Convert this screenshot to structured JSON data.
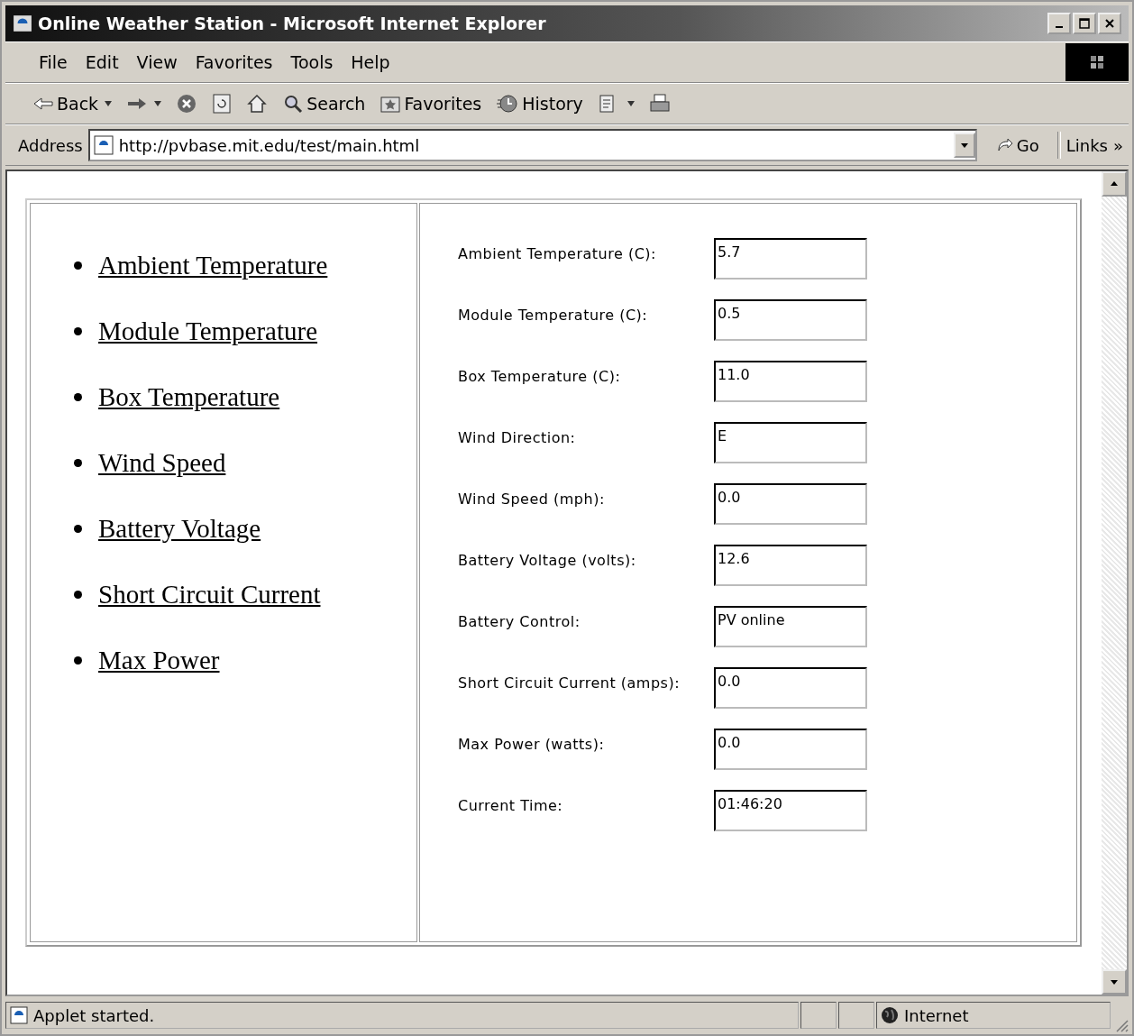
{
  "window": {
    "title": "Online Weather Station - Microsoft Internet Explorer"
  },
  "menu": [
    "File",
    "Edit",
    "View",
    "Favorites",
    "Tools",
    "Help"
  ],
  "toolbar": [
    {
      "kind": "back",
      "label": "Back"
    },
    {
      "kind": "forward"
    },
    {
      "kind": "stop"
    },
    {
      "kind": "refresh"
    },
    {
      "kind": "home"
    },
    {
      "kind": "search",
      "label": "Search"
    },
    {
      "kind": "favorites",
      "label": "Favorites"
    },
    {
      "kind": "history",
      "label": "History"
    },
    {
      "kind": "edit"
    },
    {
      "kind": "print"
    }
  ],
  "address": {
    "label": "Address",
    "value": "http://pvbase.mit.edu/test/main.html",
    "go": "Go",
    "links": "Links",
    "chevron": "»"
  },
  "nav_links": [
    "Ambient Temperature",
    "Module Temperature",
    "Box Temperature",
    "Wind Speed",
    "Battery Voltage",
    "Short Circuit Current",
    "Max Power"
  ],
  "readings": [
    {
      "label": "Ambient Temperature (C):",
      "value": "5.7"
    },
    {
      "label": "Module Temperature (C):",
      "value": "0.5"
    },
    {
      "label": "Box Temperature (C):",
      "value": "11.0"
    },
    {
      "label": "Wind Direction:",
      "value": "E"
    },
    {
      "label": "Wind Speed (mph):",
      "value": "0.0"
    },
    {
      "label": "Battery Voltage (volts):",
      "value": "12.6"
    },
    {
      "label": "Battery Control:",
      "value": "PV online"
    },
    {
      "label": "Short Circuit Current (amps):",
      "value": "0.0"
    },
    {
      "label": "Max Power (watts):",
      "value": "0.0"
    },
    {
      "label": "Current Time:",
      "value": "01:46:20"
    }
  ],
  "status": {
    "text": "Applet started.",
    "zone": "Internet"
  }
}
